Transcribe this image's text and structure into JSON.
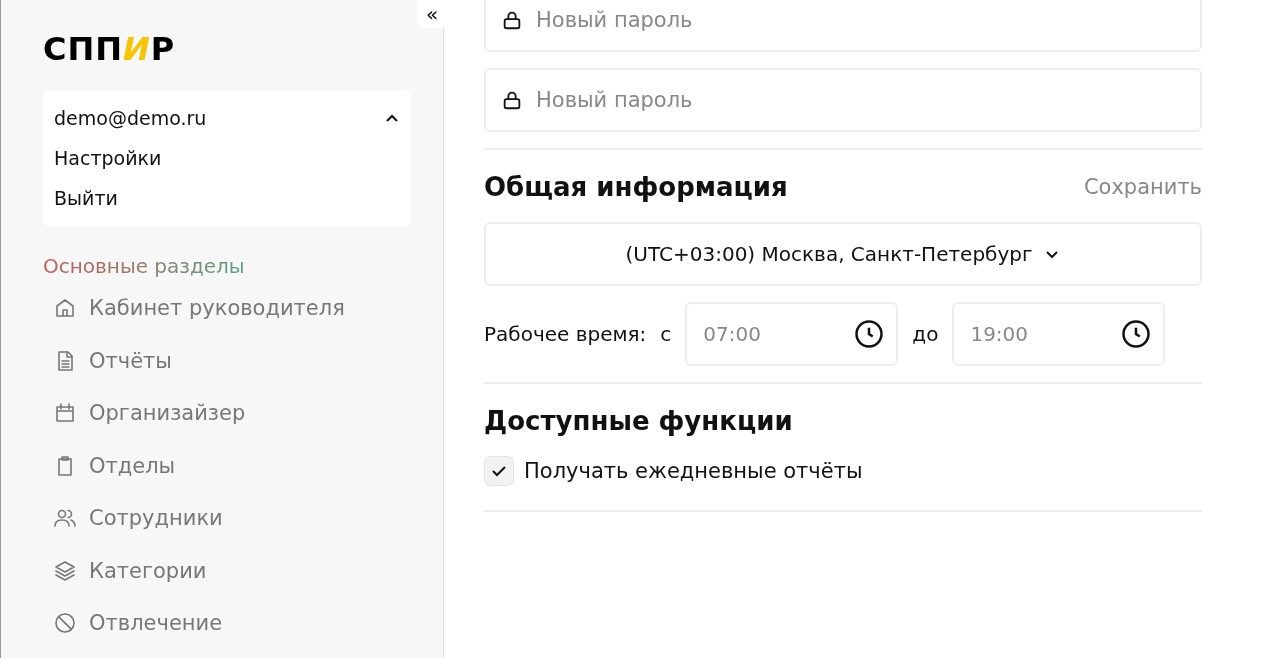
{
  "sidebar": {
    "collapse_button": "«",
    "logo": [
      {
        "text": "СПП",
        "accent": false
      },
      {
        "text": "И",
        "accent": true
      },
      {
        "text": "Р",
        "accent": false
      }
    ],
    "user_menu": {
      "email": "demo@demo.ru",
      "expanded": true,
      "items": [
        "Настройки",
        "Выйти"
      ]
    },
    "section_title": "Основные разделы",
    "nav_items": [
      {
        "label": "Кабинет руководителя"
      },
      {
        "label": "Отчёты"
      },
      {
        "label": "Организайзер"
      },
      {
        "label": "Отделы"
      },
      {
        "label": "Сотрудники"
      },
      {
        "label": "Категории"
      },
      {
        "label": "Отвлечение"
      }
    ]
  },
  "main": {
    "password_fields": [
      {
        "placeholder": "Новый пароль"
      },
      {
        "placeholder": "Новый пароль"
      }
    ],
    "general": {
      "title": "Общая информация",
      "save": "Сохранить",
      "timezone": "(UTC+03:00) Москва, Санкт-Петербург",
      "work_hours": {
        "label": "Рабочее время:",
        "from_label": "с",
        "from_placeholder": "07:00",
        "to_label": "до",
        "to_placeholder": "19:00"
      }
    },
    "features": {
      "title": "Доступные функции",
      "options": [
        {
          "label": "Получать ежедневные отчёты",
          "checked": true
        }
      ]
    }
  }
}
